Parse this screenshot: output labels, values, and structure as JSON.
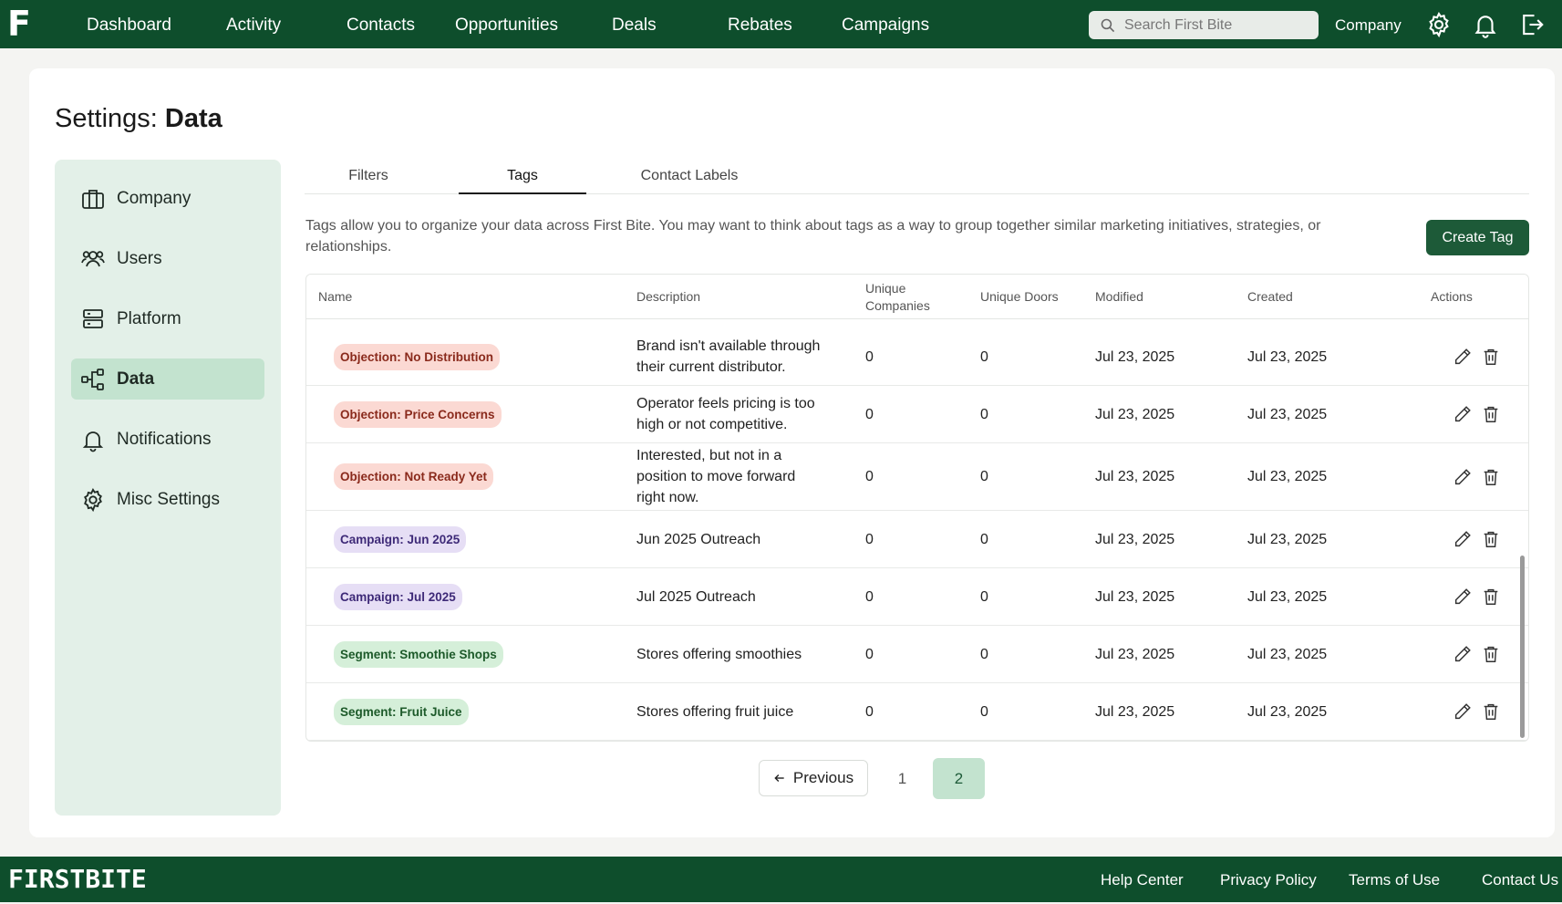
{
  "app": {
    "logo_letter": "F",
    "footer_logo": "FIRSTBITE"
  },
  "nav": {
    "items": [
      {
        "label": "Dashboard"
      },
      {
        "label": "Activity"
      },
      {
        "label": "Contacts"
      },
      {
        "label": "Opportunities"
      },
      {
        "label": "Deals"
      },
      {
        "label": "Rebates"
      },
      {
        "label": "Campaigns"
      }
    ],
    "search_placeholder": "Search First Bite",
    "company_label": "Company"
  },
  "page": {
    "title_prefix": "Settings:",
    "title_bold": "Data"
  },
  "sidebar": {
    "items": [
      {
        "label": "Company",
        "icon": "briefcase-icon"
      },
      {
        "label": "Users",
        "icon": "users-icon"
      },
      {
        "label": "Platform",
        "icon": "server-icon"
      },
      {
        "label": "Data",
        "icon": "share-nodes-icon",
        "active": true
      },
      {
        "label": "Notifications",
        "icon": "bell-icon"
      },
      {
        "label": "Misc Settings",
        "icon": "gear-icon"
      }
    ]
  },
  "tabs": [
    {
      "label": "Filters"
    },
    {
      "label": "Tags",
      "active": true
    },
    {
      "label": "Contact Labels"
    }
  ],
  "intro_text": "Tags allow you to organize your data across First Bite. You may want to think about tags as a way to group together similar marketing initiatives, strategies, or relationships.",
  "create_button": "Create Tag",
  "table": {
    "headers": {
      "name": "Name",
      "description": "Description",
      "unique_companies_1": "Unique",
      "unique_companies_2": "Companies",
      "unique_doors": "Unique Doors",
      "modified": "Modified",
      "created": "Created",
      "actions": "Actions"
    },
    "rows": [
      {
        "name": "Objection: No Distribution",
        "kind": "objection",
        "desc_lines": [
          "Brand isn't available through",
          "their current distributor."
        ],
        "companies": "0",
        "doors": "0",
        "modified": "Jul 23, 2025",
        "created": "Jul 23, 2025"
      },
      {
        "name": "Objection: Price Concerns",
        "kind": "objection",
        "desc_lines": [
          "Operator feels pricing is too",
          "high or not competitive."
        ],
        "companies": "0",
        "doors": "0",
        "modified": "Jul 23, 2025",
        "created": "Jul 23, 2025"
      },
      {
        "name": "Objection: Not Ready Yet",
        "kind": "objection",
        "desc_lines": [
          "Interested, but not in a",
          "position to move forward",
          "right now."
        ],
        "companies": "0",
        "doors": "0",
        "modified": "Jul 23, 2025",
        "created": "Jul 23, 2025"
      },
      {
        "name": "Campaign: Jun 2025",
        "kind": "campaign",
        "desc_lines": [
          "Jun 2025 Outreach"
        ],
        "companies": "0",
        "doors": "0",
        "modified": "Jul 23, 2025",
        "created": "Jul 23, 2025"
      },
      {
        "name": "Campaign: Jul 2025",
        "kind": "campaign",
        "desc_lines": [
          "Jul 2025 Outreach"
        ],
        "companies": "0",
        "doors": "0",
        "modified": "Jul 23, 2025",
        "created": "Jul 23, 2025"
      },
      {
        "name": "Segment: Smoothie Shops",
        "kind": "segment",
        "desc_lines": [
          "Stores offering smoothies"
        ],
        "companies": "0",
        "doors": "0",
        "modified": "Jul 23, 2025",
        "created": "Jul 23, 2025"
      },
      {
        "name": "Segment: Fruit Juice",
        "kind": "segment",
        "desc_lines": [
          "Stores offering fruit juice"
        ],
        "companies": "0",
        "doors": "0",
        "modified": "Jul 23, 2025",
        "created": "Jul 23, 2025"
      }
    ]
  },
  "tag_colors": {
    "objection": {
      "bg": "#fbd9d3",
      "fg": "#8a2a1c"
    },
    "campaign": {
      "bg": "#e6def5",
      "fg": "#3e2a78"
    },
    "segment": {
      "bg": "#d5efd9",
      "fg": "#1d5a2a"
    }
  },
  "pagination": {
    "previous_label": "Previous",
    "pages": [
      "1",
      "2"
    ],
    "current": "2"
  },
  "footer": {
    "links": [
      {
        "label": "Help Center"
      },
      {
        "label": "Privacy Policy"
      },
      {
        "label": "Terms of Use"
      },
      {
        "label": "Contact Us"
      }
    ]
  },
  "colors": {
    "brand": "#0e4e2c",
    "accent": "#1d5a38",
    "active_bg": "#c3e3cf"
  }
}
